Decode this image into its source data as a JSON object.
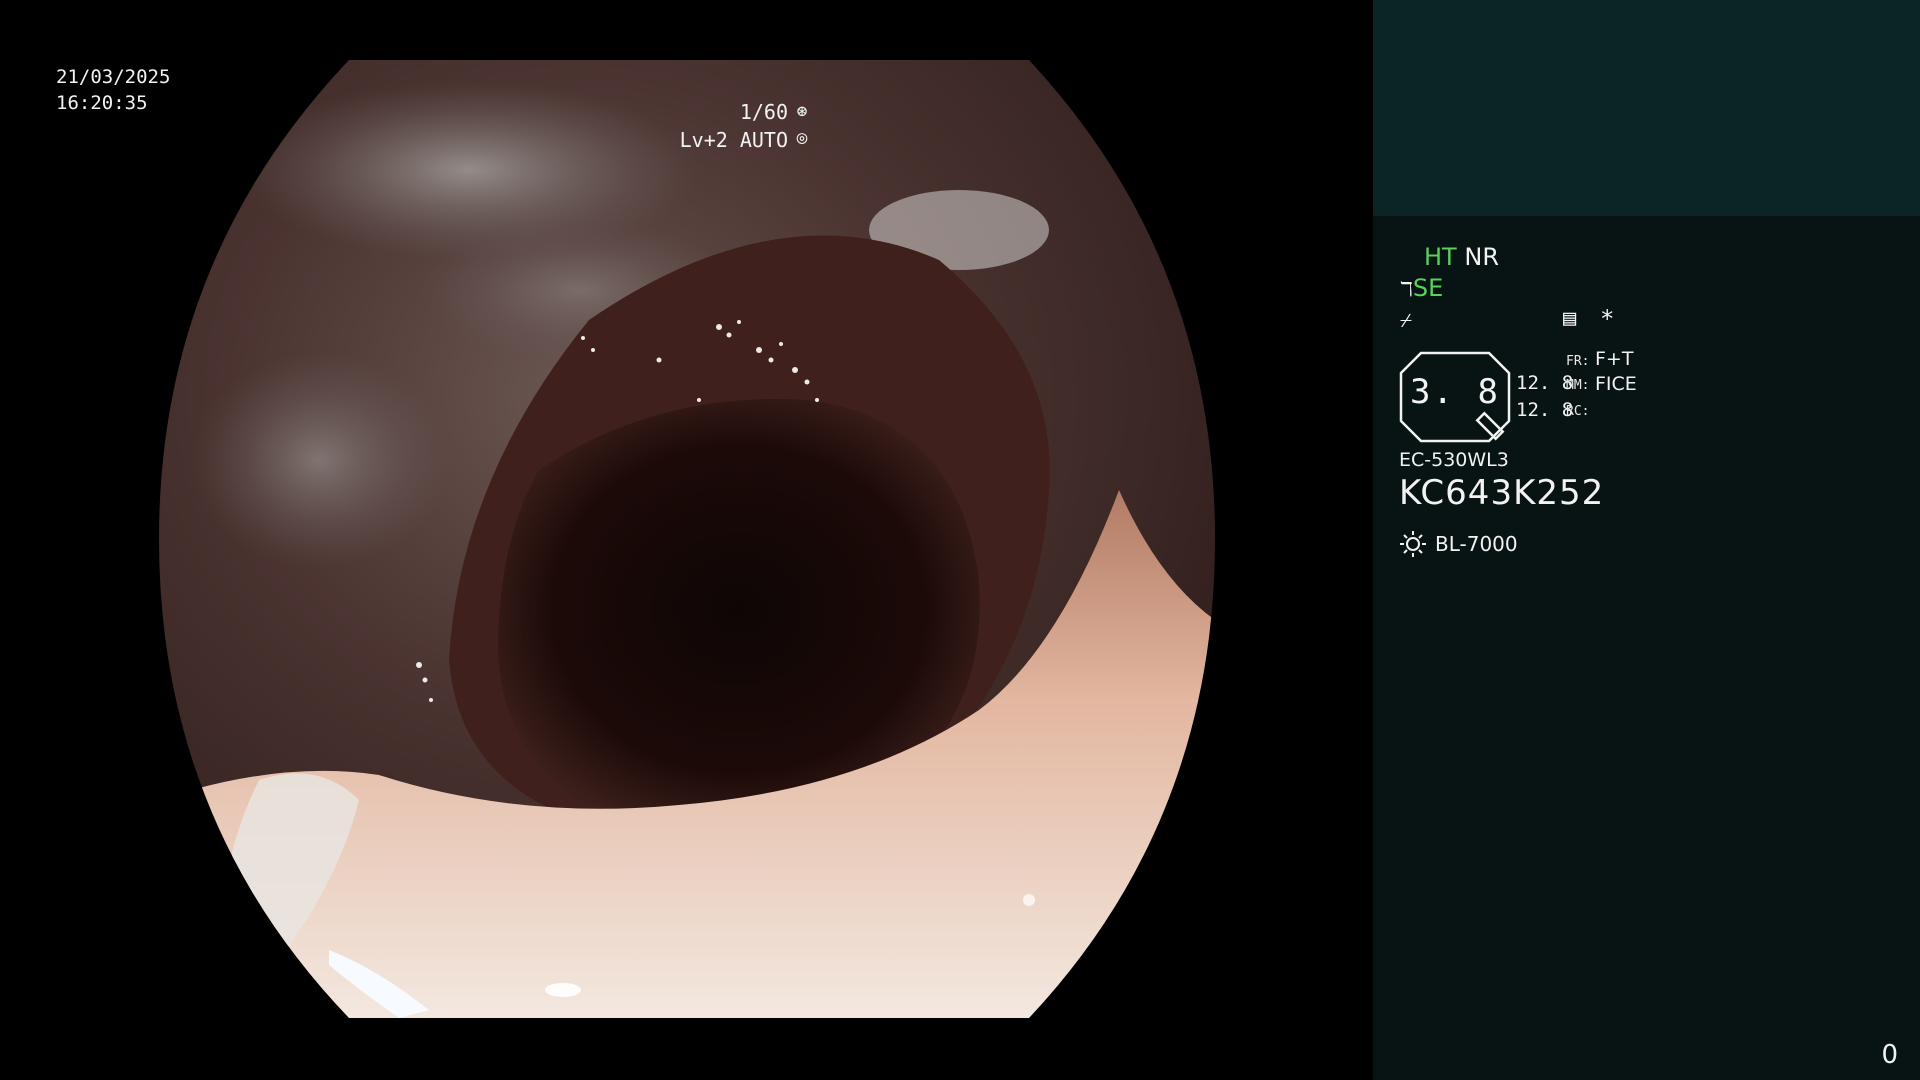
{
  "overlay": {
    "date": "21/03/2025",
    "time": "16:20:35",
    "shutter": "1/60",
    "shutter_icon": "aperture-icon",
    "level": "Lv+2 AUTO",
    "auto_icon": "iris-icon"
  },
  "panel": {
    "accent_color": "#5ad25a",
    "mode_ht": "HT",
    "mode_nr": "NR",
    "mode_se": "SE",
    "mode_se_icon": "structure-enhance-icon",
    "mode_f_icon": "filter-icon",
    "pref_icon": "preset-icon",
    "star": "*",
    "zoom_value": "3. 8",
    "num_1": "12. 8",
    "num_2": "12. 8",
    "fr_label": "FR:",
    "fr_value": "F+T",
    "mm_label": "MM:",
    "mm_value": "FICE",
    "rc_label": "RC:",
    "scope_model": "EC-530WL3",
    "serial": "KC643K252",
    "light_source": "BL-7000",
    "page_counter": "0"
  }
}
